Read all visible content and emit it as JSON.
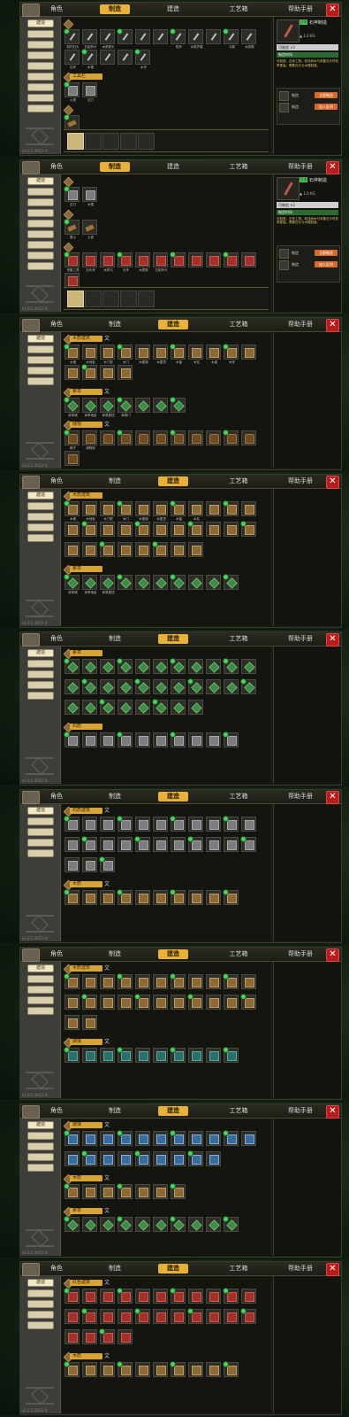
{
  "screens": [
    {
      "tabs": [
        "角色",
        "制造",
        "建造",
        "工艺箱",
        "帮助手册"
      ],
      "active_tab": 1,
      "sidebar_count": 9,
      "groups": [
        {
          "name": "",
          "ext": "",
          "items": [
            "制作石头",
            "石制斧头",
            "木质箭头",
            "",
            "",
            "",
            "短矛",
            "木质护盾",
            "",
            "弓箭",
            "木质箭",
            "石斧",
            "木棍",
            "",
            "",
            "木矛"
          ],
          "shape": "tool"
        },
        {
          "name": "工具栏",
          "ext": "",
          "items": [
            "火把",
            "石刀"
          ],
          "shape": "stone"
        },
        {
          "name": "",
          "ext": "",
          "items": [
            "篝火"
          ],
          "shape": "plank"
        }
      ],
      "queue": true,
      "detail": true
    },
    {
      "tabs": [
        "角色",
        "制造",
        "建造",
        "工艺箱",
        "帮助手册"
      ],
      "active_tab": 1,
      "sidebar_count": 9,
      "groups": [
        {
          "name": "",
          "ext": "",
          "items": [
            "石刀",
            "木棍"
          ],
          "shape": "stone"
        },
        {
          "name": "",
          "ext": "",
          "items": [
            "篝火",
            "火把"
          ],
          "shape": "plank"
        },
        {
          "name": "",
          "ext": "",
          "items": [
            "采集工具",
            "石头斧",
            "木质弓",
            "长矛",
            "木质箭",
            "石制矛头",
            "",
            "",
            "",
            "",
            "",
            ""
          ],
          "shape": "red"
        }
      ],
      "queue": true,
      "detail": true
    },
    {
      "tabs": [
        "角色",
        "制造",
        "建造",
        "工艺箱",
        "帮助手册"
      ],
      "active_tab": 2,
      "sidebar_count": 5,
      "groups": [
        {
          "name": "木质建筑",
          "ext": "文",
          "items": [
            "木墙",
            "木地板",
            "木门框",
            "木门",
            "木楼梯",
            "木屋顶",
            "木窗",
            "木柱",
            "木桌",
            "木床",
            "",
            "",
            "",
            "",
            ""
          ],
          "shape": "wall"
        },
        {
          "name": "茅草",
          "ext": "文",
          "items": [
            "茅草墙",
            "茅草地板",
            "茅草屋顶",
            "茅草门",
            "",
            "",
            ""
          ],
          "shape": "green"
        },
        {
          "name": "储物",
          "ext": "文",
          "items": [
            "箱子",
            "储物架",
            "",
            "",
            "",
            "",
            "",
            "",
            "",
            "",
            "",
            ""
          ],
          "shape": "chest"
        }
      ]
    },
    {
      "tabs": [
        "角色",
        "制造",
        "建造",
        "工艺箱",
        "帮助手册"
      ],
      "active_tab": 2,
      "sidebar_count": 5,
      "groups": [
        {
          "name": "木质建筑",
          "ext": "",
          "items": [
            "木墙",
            "木地板",
            "木门框",
            "木门",
            "木楼梯",
            "木屋顶",
            "木窗",
            "木柱",
            "",
            "",
            "",
            "",
            "",
            "",
            "",
            "",
            "",
            "",
            "",
            "",
            "",
            "",
            "",
            "",
            "",
            "",
            "",
            "",
            "",
            ""
          ],
          "shape": "wall"
        },
        {
          "name": "茅草",
          "ext": "",
          "items": [
            "茅草墙",
            "茅草地板",
            "茅草屋顶",
            "",
            "",
            "",
            "",
            "",
            "",
            ""
          ],
          "shape": "green"
        }
      ]
    },
    {
      "tabs": [
        "角色",
        "制造",
        "建造",
        "工艺箱",
        "帮助手册"
      ],
      "active_tab": 2,
      "sidebar_count": 5,
      "groups": [
        {
          "name": "茅草",
          "ext": "",
          "items": [
            "",
            "",
            "",
            "",
            "",
            "",
            "",
            "",
            "",
            "",
            "",
            "",
            "",
            "",
            "",
            "",
            "",
            "",
            "",
            "",
            "",
            "",
            "",
            "",
            "",
            "",
            "",
            "",
            "",
            ""
          ],
          "shape": "green"
        },
        {
          "name": "石质",
          "ext": "",
          "items": [
            "",
            "",
            "",
            "",
            "",
            "",
            "",
            "",
            "",
            ""
          ],
          "shape": "stone"
        }
      ]
    },
    {
      "tabs": [
        "角色",
        "制造",
        "建造",
        "工艺箱",
        "帮助手册"
      ],
      "active_tab": 2,
      "sidebar_count": 5,
      "groups": [
        {
          "name": "石质建筑",
          "ext": "文",
          "items": [
            "",
            "",
            "",
            "",
            "",
            "",
            "",
            "",
            "",
            "",
            "",
            "",
            "",
            "",
            "",
            "",
            "",
            "",
            "",
            "",
            "",
            "",
            "",
            "",
            ""
          ],
          "shape": "stone"
        },
        {
          "name": "木质",
          "ext": "文",
          "items": [
            "",
            "",
            "",
            "",
            "",
            "",
            "",
            "",
            "",
            ""
          ],
          "shape": "wall"
        }
      ]
    },
    {
      "tabs": [
        "角色",
        "制造",
        "建造",
        "工艺箱",
        "帮助手册"
      ],
      "active_tab": 2,
      "sidebar_count": 5,
      "groups": [
        {
          "name": "木质建筑",
          "ext": "文",
          "items": [
            "",
            "",
            "",
            "",
            "",
            "",
            "",
            "",
            "",
            "",
            "",
            "",
            "",
            "",
            "",
            "",
            "",
            "",
            "",
            "",
            "",
            "",
            "",
            ""
          ],
          "shape": "wall"
        },
        {
          "name": "玻璃",
          "ext": "文",
          "items": [
            "",
            "",
            "",
            "",
            "",
            "",
            "",
            "",
            "",
            ""
          ],
          "shape": "teal"
        }
      ]
    },
    {
      "tabs": [
        "角色",
        "制造",
        "建造",
        "工艺箱",
        "帮助手册"
      ],
      "active_tab": 2,
      "sidebar_count": 5,
      "groups": [
        {
          "name": "玻璃",
          "ext": "文",
          "items": [
            "",
            "",
            "",
            "",
            "",
            "",
            "",
            "",
            "",
            "",
            "",
            "",
            "",
            "",
            "",
            "",
            "",
            "",
            "",
            ""
          ],
          "shape": "glass"
        },
        {
          "name": "木质",
          "ext": "文",
          "items": [
            "",
            "",
            "",
            "",
            "",
            "",
            ""
          ],
          "shape": "wall"
        },
        {
          "name": "茅草",
          "ext": "文",
          "items": [
            "",
            "",
            "",
            "",
            "",
            "",
            "",
            "",
            "",
            ""
          ],
          "shape": "green"
        }
      ]
    },
    {
      "tabs": [
        "角色",
        "制造",
        "建造",
        "工艺箱",
        "帮助手册"
      ],
      "active_tab": 2,
      "sidebar_count": 5,
      "groups": [
        {
          "name": "红色建筑",
          "ext": "文",
          "items": [
            "",
            "",
            "",
            "",
            "",
            "",
            "",
            "",
            "",
            "",
            "",
            "",
            "",
            "",
            "",
            "",
            "",
            "",
            "",
            "",
            "",
            "",
            "",
            "",
            "",
            ""
          ],
          "shape": "red"
        },
        {
          "name": "木质",
          "ext": "文",
          "items": [
            "",
            "",
            "",
            "",
            "",
            "",
            "",
            "",
            "",
            ""
          ],
          "shape": "wall"
        }
      ]
    }
  ],
  "detail": {
    "name": "石斧制造",
    "badge": "已学",
    "qty": "▲ 1.0 KG",
    "hdr": "可制造 ×1",
    "green": "制造时间",
    "desc": "可制造，石斧工具。砍伐树木与采集石头时效率更高。需要石头与木棍制造。",
    "craft_label": "制造",
    "craft_btn1": "立即制造",
    "craft_btn2": "加入队列"
  },
  "sidebar_label": "建造",
  "footer": "v1.0.2 2023 ©"
}
